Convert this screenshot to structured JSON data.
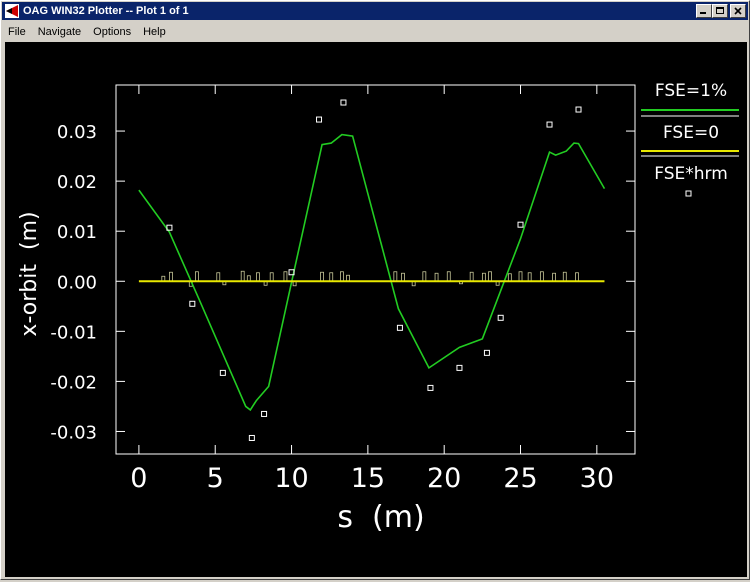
{
  "window": {
    "title": "OAG WIN32 Plotter -- Plot 1 of 1",
    "buttons": {
      "minimize": "_",
      "maximize": "□",
      "close": "×"
    }
  },
  "menu": [
    "File",
    "Navigate",
    "Options",
    "Help"
  ],
  "colors": {
    "titlebar": "#0a246a",
    "plot_bg": "#000000",
    "fse1": "#22cc22",
    "fse0": "#e8e800",
    "axes": "#ffffff"
  },
  "chart_data": {
    "type": "line",
    "xlabel": "s  (m)",
    "ylabel": "x-orbit  (m)",
    "xlim": [
      -1.5,
      32.5
    ],
    "ylim": [
      -0.0345,
      0.0392
    ],
    "xticks": [
      0,
      5,
      10,
      15,
      20,
      25,
      30
    ],
    "xtick_labels": [
      "0",
      "5",
      "10",
      "15",
      "20",
      "25",
      "30"
    ],
    "yticks": [
      -0.03,
      -0.02,
      -0.01,
      0.0,
      0.01,
      0.02,
      0.03
    ],
    "ytick_labels": [
      "-0.03",
      "-0.02",
      "-0.01",
      "0.00",
      "0.01",
      "0.02",
      "0.03"
    ],
    "legend": [
      {
        "label": "FSE=1%",
        "style": "line",
        "color": "#22cc22"
      },
      {
        "label": "FSE=0",
        "style": "line",
        "color": "#e8e800"
      },
      {
        "label": "FSE*hrm",
        "style": "marker",
        "color": "#ffffff"
      }
    ],
    "series": [
      {
        "name": "FSE=1%",
        "x": [
          0.0,
          2.0,
          4.0,
          7.0,
          7.3,
          7.7,
          8.5,
          10.0,
          12.0,
          12.6,
          13.3,
          14.0,
          17.0,
          19.0,
          21.0,
          22.5,
          25.0,
          26.9,
          27.3,
          28.0,
          28.5,
          28.8,
          30.5
        ],
        "y": [
          0.0182,
          0.0098,
          -0.004,
          -0.025,
          -0.0257,
          -0.0238,
          -0.021,
          -0.0002,
          0.0273,
          0.0276,
          0.0293,
          0.029,
          -0.0055,
          -0.0173,
          -0.0132,
          -0.0115,
          0.0085,
          0.0258,
          0.0252,
          0.026,
          0.0276,
          0.0275,
          0.0185
        ]
      },
      {
        "name": "FSE=0",
        "x": [
          0.0,
          30.5
        ],
        "y": [
          0.0,
          0.0
        ]
      },
      {
        "name": "FSE*hrm",
        "x": [
          2.0,
          3.5,
          5.5,
          7.4,
          8.2,
          10.0,
          11.8,
          13.4,
          17.1,
          19.1,
          21.0,
          22.8,
          23.7,
          25.0,
          26.9,
          28.8
        ],
        "y": [
          0.0107,
          -0.0045,
          -0.0183,
          -0.0313,
          -0.0265,
          0.0018,
          0.0323,
          0.0357,
          -0.0093,
          -0.0213,
          -0.0173,
          -0.0143,
          -0.0073,
          0.0113,
          0.0313,
          0.0343
        ]
      }
    ],
    "bars_x": [
      1.6,
      2.1,
      3.4,
      3.8,
      5.2,
      5.6,
      6.8,
      7.2,
      7.8,
      8.3,
      8.7,
      9.6,
      10.2,
      12.0,
      12.6,
      13.3,
      13.7,
      16.8,
      17.3,
      18.0,
      18.7,
      19.5,
      20.3,
      21.1,
      21.8,
      22.6,
      23.0,
      23.5,
      24.3,
      25.0,
      25.6,
      26.4,
      27.2,
      27.9,
      28.7
    ],
    "bars_y": [
      0.001,
      0.0018,
      -0.001,
      0.0019,
      0.0017,
      -0.0007,
      0.002,
      0.0011,
      0.0017,
      -0.0008,
      0.0017,
      0.0019,
      -0.0009,
      0.0018,
      0.0017,
      0.0019,
      0.0012,
      0.0019,
      0.0016,
      -0.0009,
      0.0019,
      0.0016,
      0.0019,
      -0.0005,
      0.0018,
      0.0016,
      0.0019,
      -0.0008,
      0.0015,
      0.0019,
      0.0017,
      0.0019,
      0.0016,
      0.0018,
      0.0017
    ]
  }
}
